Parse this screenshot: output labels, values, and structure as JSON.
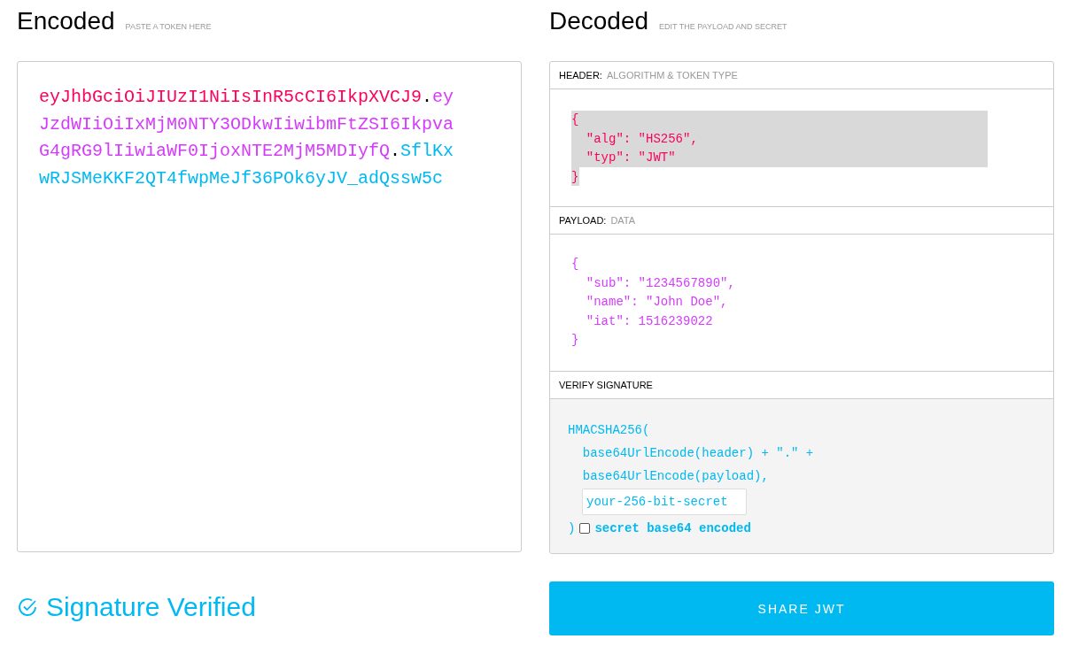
{
  "encoded": {
    "title": "Encoded",
    "subtitle": "PASTE A TOKEN HERE",
    "segments": [
      {
        "text": "eyJhbGciOiJIUzI1NiIsInR5cCI6IkpXVCJ9",
        "color": "#fb015b"
      },
      {
        "text": ".",
        "color": "#000000"
      },
      {
        "text": "eyJzdWIiOiIxMjM0NTY3ODkwIiwibmFtZSI6IkpvaG4gRG9lIiwiaWF0IjoxNTE2MjM5MDIyfQ",
        "color": "#d63aff"
      },
      {
        "text": ".",
        "color": "#000000"
      },
      {
        "text": "SflKxwRJSMeKKF2QT4fwpMeJf36POk6yJV_adQssw5c",
        "color": "#00b9f1"
      }
    ]
  },
  "decoded": {
    "title": "Decoded",
    "subtitle": "EDIT THE PAYLOAD AND SECRET",
    "header": {
      "label": "HEADER:",
      "sublabel": "ALGORITHM & TOKEN TYPE",
      "highlighted": true,
      "lines": [
        "{",
        "  \"alg\": \"HS256\",",
        "  \"typ\": \"JWT\"",
        "}"
      ]
    },
    "payload": {
      "label": "PAYLOAD:",
      "sublabel": "DATA",
      "highlighted": false,
      "lines": [
        "{",
        "  \"sub\": \"1234567890\",",
        "  \"name\": \"John Doe\",",
        "  \"iat\": 1516239022",
        "}"
      ]
    },
    "verify": {
      "label": "VERIFY SIGNATURE",
      "lines": [
        "HMACSHA256(",
        "  base64UrlEncode(header) + \".\" +",
        "  base64UrlEncode(payload),"
      ],
      "secret": "your-256-bit-secret",
      "close": ")",
      "base64_checked": false,
      "base64_label": "secret base64 encoded"
    }
  },
  "status": {
    "text": "Signature Verified"
  },
  "share_button": "SHARE JWT"
}
